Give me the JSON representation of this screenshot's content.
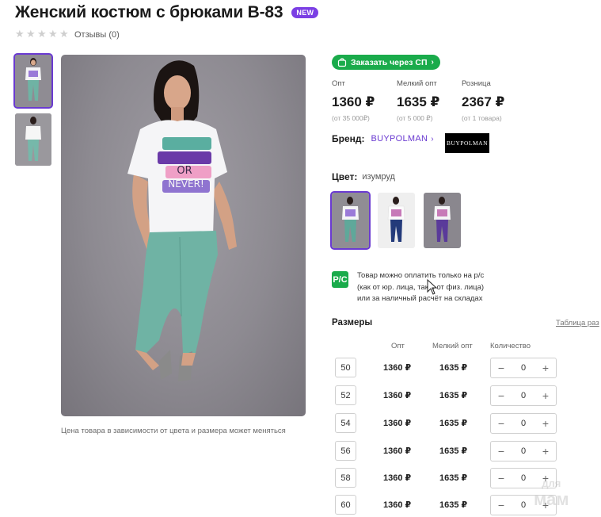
{
  "product": {
    "title": "Женский костюм с брюками В-83",
    "badge": "NEW",
    "reviews": "Отзывы (0)",
    "photo_note": "Цена товара в зависимости от цвета и размера может меняться",
    "main_photo_print": [
      "OR",
      "NEVER!"
    ]
  },
  "order_button": {
    "label": "Заказать через СП",
    "icon": "cart-icon"
  },
  "prices": [
    {
      "label": "Опт",
      "value": "1360 ₽",
      "note": "(от 35 000₽)"
    },
    {
      "label": "Мелкий опт",
      "value": "1635 ₽",
      "note": "(от 5 000 ₽)"
    },
    {
      "label": "Розница",
      "value": "2367 ₽",
      "note": "(от 1 товара)"
    }
  ],
  "brand": {
    "label": "Бренд:",
    "name": "BUYPOLMAN",
    "logo_text": "BUYPOLMAN"
  },
  "color": {
    "label": "Цвет:",
    "value": "изумруд"
  },
  "swatch_colors": [
    "#5fa89a",
    "#233a7a",
    "#5a3a9a"
  ],
  "payment": {
    "icon_text": "P/C",
    "lines": [
      "Товар можно оплатить только на р/с",
      "(как от юр. лица, так и от физ. лица)",
      "или за наличный расчёт на складах"
    ]
  },
  "sizes": {
    "title": "Размеры",
    "table_link": "Таблица раз",
    "headers": {
      "opt": "Опт",
      "small_opt": "Мелкий опт",
      "qty": "Количество"
    },
    "rows": [
      {
        "size": "50",
        "opt": "1360 ₽",
        "small_opt": "1635 ₽",
        "qty": "0"
      },
      {
        "size": "52",
        "opt": "1360 ₽",
        "small_opt": "1635 ₽",
        "qty": "0"
      },
      {
        "size": "54",
        "opt": "1360 ₽",
        "small_opt": "1635 ₽",
        "qty": "0"
      },
      {
        "size": "56",
        "opt": "1360 ₽",
        "small_opt": "1635 ₽",
        "qty": "0"
      },
      {
        "size": "58",
        "opt": "1360 ₽",
        "small_opt": "1635 ₽",
        "qty": "0"
      },
      {
        "size": "60",
        "opt": "1360 ₽",
        "small_opt": "1635 ₽",
        "qty": "0"
      }
    ]
  },
  "watermark": {
    "top": "для",
    "bottom": "мам"
  },
  "colors": {
    "accent": "#6a3ad1",
    "green": "#1aab4b",
    "pants": "#6fb3a4"
  }
}
